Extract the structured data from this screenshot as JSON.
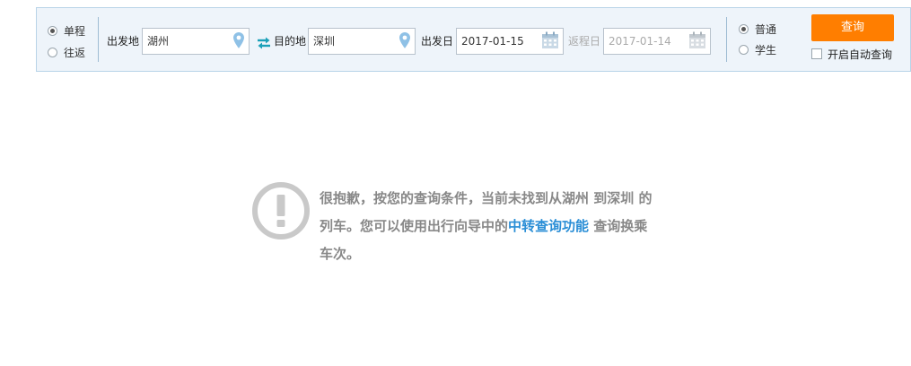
{
  "trip_type": {
    "options": [
      {
        "label": "单程",
        "checked": true
      },
      {
        "label": "往返",
        "checked": false
      }
    ]
  },
  "from": {
    "label": "出发地",
    "value": "湖州"
  },
  "to": {
    "label": "目的地",
    "value": "深圳"
  },
  "depart_date": {
    "label": "出发日",
    "value": "2017-01-15"
  },
  "return_date": {
    "label": "返程日",
    "value": "2017-01-14"
  },
  "passenger_type": {
    "options": [
      {
        "label": "普通",
        "checked": true
      },
      {
        "label": "学生",
        "checked": false
      }
    ]
  },
  "query_button": "查询",
  "auto_query_label": "开启自动查询",
  "notice": {
    "line1": "很抱歉，按您的查询条件，当前未找到从湖州 到深圳 的",
    "line2_prefix": "列车。您可以使用出行向导中的",
    "link": "中转查询功能",
    "line2_suffix": " 查询换乘",
    "line3": "车次。"
  },
  "colors": {
    "accent": "#ff7e00",
    "link": "#2a8ed6",
    "location_icon": "#8fc1e6",
    "swap_icon": "#1aa0b8"
  }
}
